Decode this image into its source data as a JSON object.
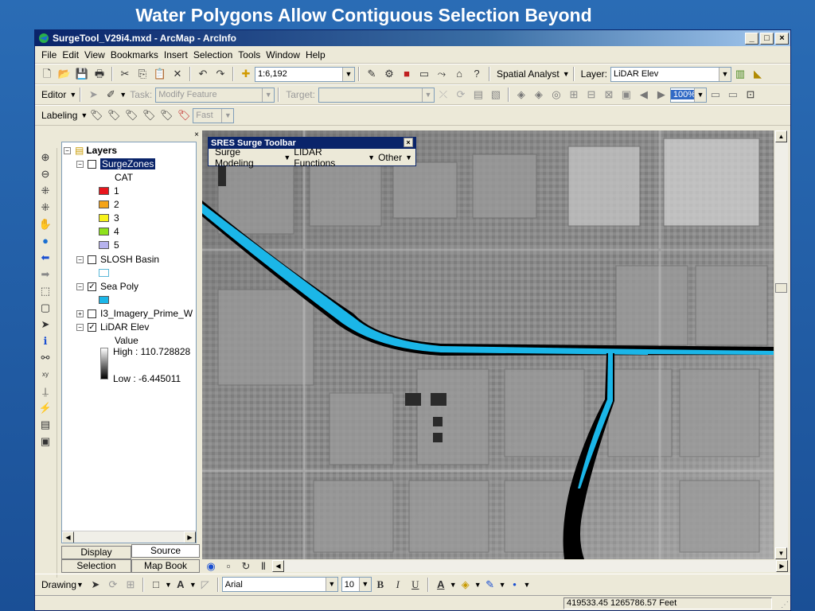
{
  "slide": {
    "title": "Water Polygons Allow Contiguous Selection Beyond"
  },
  "window": {
    "title": "SurgeTool_V29i4.mxd - ArcMap - ArcInfo",
    "controls": {
      "minimize": "_",
      "maximize": "□",
      "close": "×"
    }
  },
  "menu": [
    "File",
    "Edit",
    "View",
    "Bookmarks",
    "Insert",
    "Selection",
    "Tools",
    "Window",
    "Help"
  ],
  "standard_toolbar": {
    "scale": "1:6,192",
    "spatial_analyst": "Spatial Analyst",
    "layer_label": "Layer:",
    "layer_value": "LiDAR Elev"
  },
  "editor_toolbar": {
    "editor": "Editor",
    "task_label": "Task:",
    "task_value": "Modify Feature",
    "target_label": "Target:",
    "target_value": "",
    "zoom_value": "100%"
  },
  "labeling_toolbar": {
    "labeling": "Labeling",
    "speed": "Fast"
  },
  "toc": {
    "root": "Layers",
    "surgezones": {
      "name": "SurgeZones",
      "field": "CAT",
      "classes": [
        {
          "label": "1",
          "color": "#e8161c"
        },
        {
          "label": "2",
          "color": "#f5a418"
        },
        {
          "label": "3",
          "color": "#f7f21a"
        },
        {
          "label": "4",
          "color": "#8fe21c"
        },
        {
          "label": "5",
          "color": "#b6b2ee"
        }
      ]
    },
    "slosh": {
      "name": "SLOSH Basin",
      "color": "#ffffff"
    },
    "seapoly": {
      "name": "Sea Poly",
      "color": "#1bb6e8"
    },
    "imagery": {
      "name": "I3_Imagery_Prime_W"
    },
    "lidar": {
      "name": "LiDAR Elev",
      "field": "Value",
      "high": "High : 110.728828",
      "low": "Low : -6.445011"
    },
    "tabs": {
      "display": "Display",
      "source": "Source",
      "selection": "Selection",
      "mapbook": "Map Book"
    }
  },
  "floating_toolbar": {
    "title": "SRES Surge Toolbar",
    "menus": [
      "Surge Modeling",
      "LIDAR Functions",
      "Other"
    ]
  },
  "drawing_toolbar": {
    "drawing": "Drawing",
    "font": "Arial",
    "size": "10"
  },
  "status": {
    "coords": "419533.45  1265786.57 Feet"
  },
  "colors": {
    "water": "#1bb6e8",
    "titlebar": "#0a246a"
  }
}
